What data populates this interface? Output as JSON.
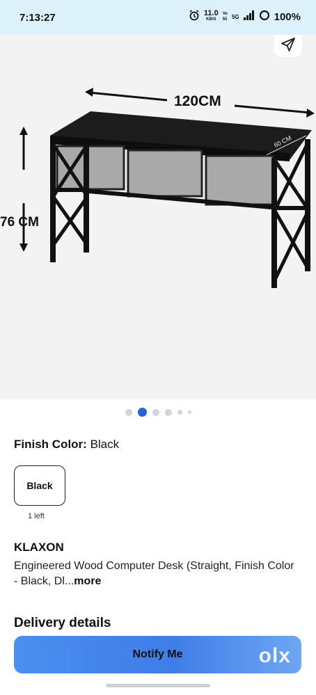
{
  "status": {
    "time": "7:13:27",
    "speed_value": "11.0",
    "speed_unit": "KB/S",
    "volte_top": "Vo",
    "volte_bottom": "55",
    "network": "5G",
    "battery": "100%"
  },
  "product_image": {
    "width_label": "120CM",
    "height_label": "76 CM",
    "depth_label": "60 CM",
    "carousel_count": 6,
    "carousel_active_index": 1
  },
  "variant": {
    "label": "Finish Color:",
    "value": "Black",
    "options": [
      {
        "label": "Black",
        "stock": "1 left"
      }
    ]
  },
  "product": {
    "brand": "KLAXON",
    "title": "Engineered Wood Computer Desk (Straight, Finish Color - Black, Dl...",
    "more": "more"
  },
  "section": {
    "delivery_heading": "Delivery details"
  },
  "cta": {
    "label": "Notify Me",
    "watermark": "olx"
  }
}
